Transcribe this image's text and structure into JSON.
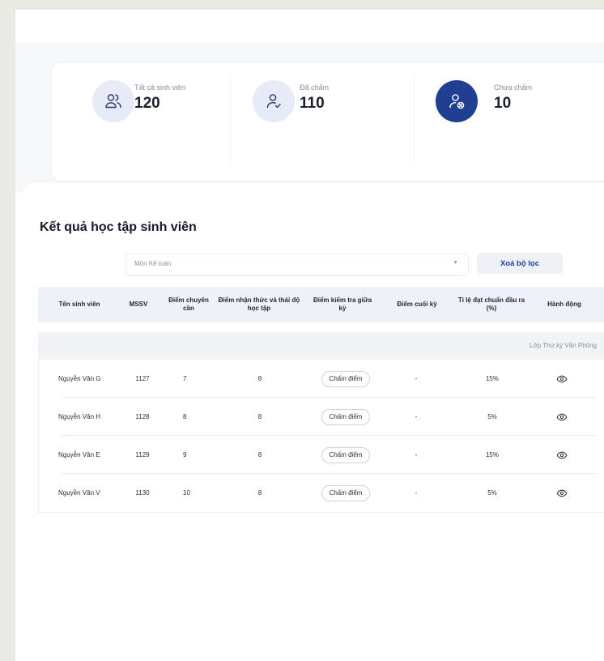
{
  "stats": [
    {
      "label": "Tất cả sinh viên",
      "value": "120",
      "icon": "users-icon"
    },
    {
      "label": "Đã chấm",
      "value": "110",
      "icon": "user-check-icon"
    },
    {
      "label": "Chưa chấm",
      "value": "10",
      "icon": "user-x-icon"
    }
  ],
  "results": {
    "title": "Kết quả học tập sinh viên",
    "filter": {
      "selected": "Môn Kế toán"
    },
    "clear_filter_label": "Xoá bộ lọc",
    "columns": [
      "Tên sinh viên",
      "MSSV",
      "Điểm chuyên cần",
      "Điểm nhận thức và thái độ học tập",
      "Điểm kiểm tra giữa kỳ",
      "Điểm cuối kỳ",
      "Tỉ lệ đạt chuẩn đầu ra (%)",
      "Hành động"
    ],
    "group_label": "Lớp Thư ký Văn Phòng",
    "rows": [
      {
        "name": "Nguyễn Văn G",
        "mssv": "1127",
        "attendance": "7",
        "awareness": "8",
        "midterm": "Chấm điểm",
        "final": "-",
        "rate": "15%"
      },
      {
        "name": "Nguyễn Văn H",
        "mssv": "1128",
        "attendance": "8",
        "awareness": "8",
        "midterm": "Chấm điểm",
        "final": "-",
        "rate": "5%"
      },
      {
        "name": "Nguyễn Văn E",
        "mssv": "1129",
        "attendance": "9",
        "awareness": "8",
        "midterm": "Chấm điểm",
        "final": "-",
        "rate": "15%"
      },
      {
        "name": "Nguyễn Văn V",
        "mssv": "1130",
        "attendance": "10",
        "awareness": "8",
        "midterm": "Chấm điểm",
        "final": "-",
        "rate": "5%"
      }
    ]
  },
  "colors": {
    "accent": "#1f3f93",
    "icon_bg": "#e6ebf7",
    "table_header_bg": "#eef1f7"
  }
}
